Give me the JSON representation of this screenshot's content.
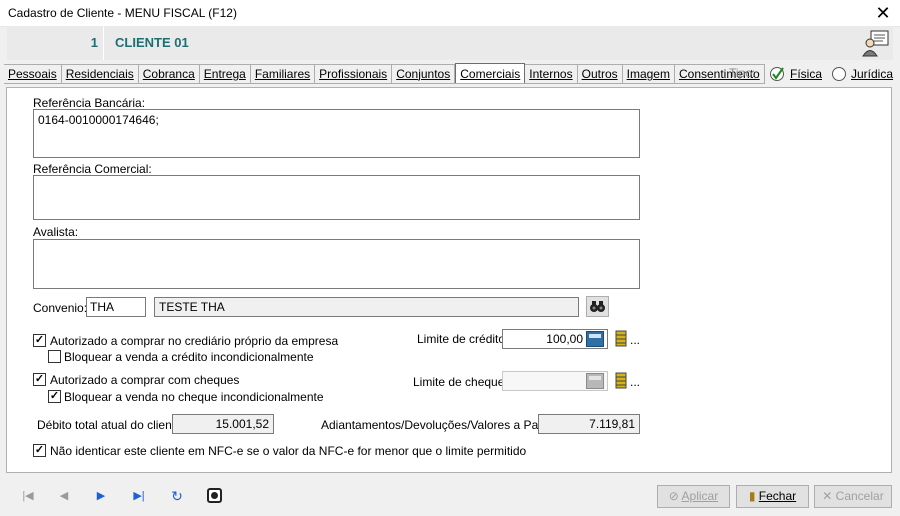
{
  "window": {
    "title": "Cadastro de Cliente - MENU FISCAL (F12)",
    "close": "✕"
  },
  "header": {
    "number": "1",
    "name": "CLIENTE 01"
  },
  "tabs": [
    "Pessoais",
    "Residenciais",
    "Cobranca",
    "Entrega",
    "Familiares",
    "Profissionais",
    "Conjuntos",
    "Comerciais",
    "Internos",
    "Outros",
    "Imagem",
    "Consentimento"
  ],
  "active_tab": "Comerciais",
  "tipo": {
    "label": "Tipo:",
    "fisica": "Física",
    "juridica": "Jurídica",
    "selected": "Física"
  },
  "form": {
    "ref_bancaria_label": "Referência Bancária:",
    "ref_bancaria_value": "0164-0010000174646;",
    "ref_comercial_label": "Referência Comercial:",
    "ref_comercial_value": "",
    "avalista_label": "Avalista:",
    "avalista_value": "",
    "convenio_label": "Convenio:",
    "convenio_code": "THA",
    "convenio_name": "TESTE THA",
    "autorizado_crediario": "Autorizado a comprar no crediário próprio da empresa",
    "bloquear_credito": "Bloquear a venda a crédito incondicionalmente",
    "autorizado_cheques": "Autorizado a comprar com cheques",
    "bloquear_cheque": "Bloquear a venda no cheque incondicionalmente",
    "limite_credito_label": "Limite de crédito:",
    "limite_credito_value": "100,00",
    "limite_cheque_label": "Limite de cheque:",
    "limite_cheque_value": "",
    "debito_label": "Débito total atual do cliente:",
    "debito_value": "15.001,52",
    "adiantamentos_label": "Adiantamentos/Devoluções/Valores a Pagar:",
    "adiantamentos_value": "7.119,81",
    "nfce_label": "Não identicar este cliente em NFC-e se o valor da NFC-e for menor que o limite permitido",
    "ellipsis": "..."
  },
  "checks": {
    "crediario": true,
    "bloquear_credito": false,
    "cheques": true,
    "bloquear_cheque": true,
    "nfce": true
  },
  "buttons": {
    "aplicar": "Aplicar",
    "fechar": "Fechar",
    "cancelar": "Cancelar"
  },
  "nav_icons": [
    "first-record-icon",
    "previous-record-icon",
    "next-record-icon",
    "last-record-icon",
    "refresh-icon",
    "record-icon"
  ],
  "colors": {
    "accent": "#1e6f74",
    "nav_blue": "#1d5fd6"
  }
}
